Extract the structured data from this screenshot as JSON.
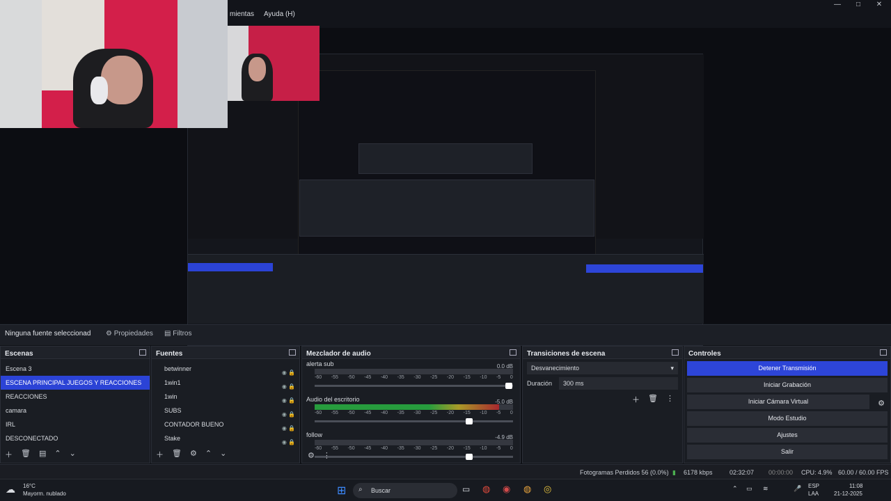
{
  "menu": {
    "items": [
      "mientas",
      "Ayuda (H)"
    ]
  },
  "window_controls": [
    "minimize-icon",
    "maximize-icon",
    "close-icon"
  ],
  "source_bar": {
    "no_source": "Ninguna fuente seleccionad",
    "props": "Propiedades",
    "filters": "Filtros"
  },
  "panels": {
    "scenes": {
      "title": "Escenas",
      "items": [
        "Escena 3",
        "ESCENA PRINCIPAL JUEGOS Y REACCIONES",
        "REACCIONES",
        "camara",
        "IRL",
        "DESCONECTADO"
      ]
    },
    "sources": {
      "title": "Fuentes",
      "items": [
        "betwinner",
        "1win1",
        "1win",
        "SUBS",
        "CONTADOR BUENO",
        "Stake"
      ]
    },
    "mixer": {
      "title": "Mezclador de audio",
      "channels": [
        {
          "name": "alerta sub",
          "db": "0.0 dB",
          "level": 0.0,
          "fader": 0.98
        },
        {
          "name": "Audio del escritorio",
          "db": "-5.0 dB",
          "level": 0.93,
          "fader": 0.78
        },
        {
          "name": "follow",
          "db": "-4.9 dB",
          "level": 0.0,
          "fader": 0.78
        }
      ],
      "ticks": [
        "-60",
        "-55",
        "-50",
        "-45",
        "-40",
        "-35",
        "-30",
        "-25",
        "-20",
        "-15",
        "-10",
        "-5",
        "0"
      ]
    },
    "transitions": {
      "title": "Transiciones de escena",
      "type": "Desvanecimiento",
      "duration_label": "Duración",
      "duration_value": "300 ms"
    },
    "controls": {
      "title": "Controles",
      "buttons": [
        "Detener Transmisión",
        "Iniciar Grabación",
        "Iniciar Cámara Virtual",
        "Modo Estudio",
        "Ajustes",
        "Salir"
      ]
    }
  },
  "status": {
    "dropped": "Fotogramas Perdidos 56 (0.0%)",
    "kbps": "6178 kbps",
    "time1": "02:32:07",
    "time2": "00:00:00",
    "cpu": "CPU: 4.9%",
    "fps": "60.00 / 60.00 FPS"
  },
  "taskbar": {
    "weather": "16°C",
    "weather_desc": "Mayorm. nublado",
    "search": "Buscar",
    "lang1": "ESP",
    "lang2": "LAA",
    "time": "11:08",
    "date": "21-12-2025"
  },
  "colors": {
    "accent": "#2d45d8",
    "selection": "#2b43d6",
    "panel_bg": "#1a1d23"
  }
}
